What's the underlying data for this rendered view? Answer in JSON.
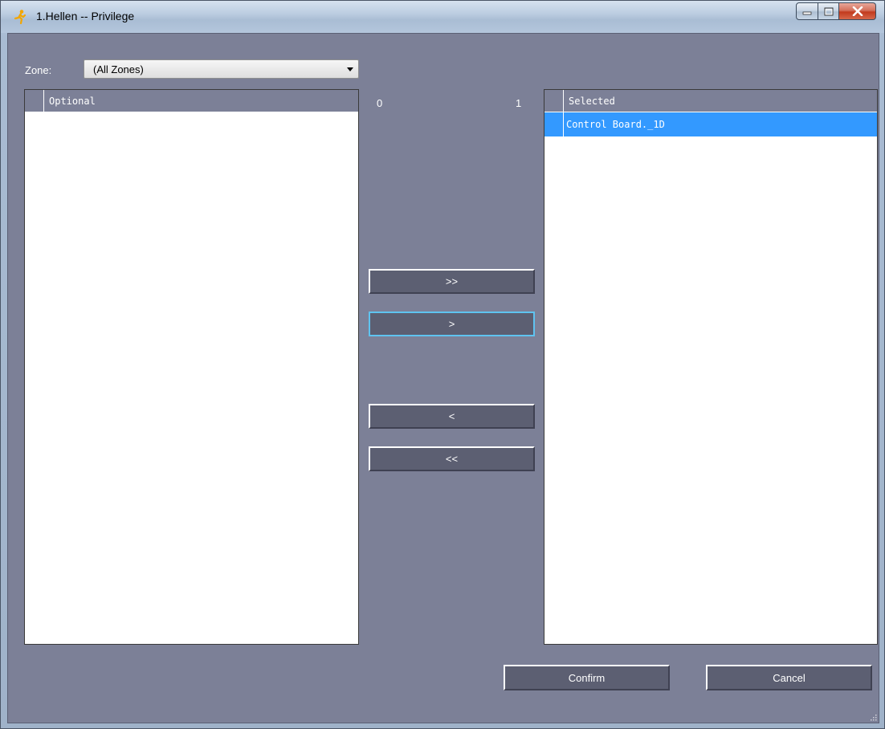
{
  "window": {
    "title": "1.Hellen -- Privilege"
  },
  "zone": {
    "label": "Zone:",
    "selected": "(All Zones)"
  },
  "optional_list": {
    "header": "Optional",
    "count": "0",
    "items": []
  },
  "selected_list": {
    "header": "Selected",
    "count": "1",
    "items": [
      "Control Board._1D"
    ]
  },
  "move_buttons": {
    "add_all": ">>",
    "add_one": ">",
    "remove_one": "<",
    "remove_all": "<<"
  },
  "actions": {
    "confirm": "Confirm",
    "cancel": "Cancel"
  },
  "colors": {
    "client_bg": "#7c8097",
    "selection": "#3399ff",
    "button_bg": "#5c5f72",
    "focus_border": "#5fc3f0"
  },
  "icons": {
    "app": "runner-icon",
    "minimize": "minimize-icon",
    "maximize": "maximize-icon",
    "close": "close-icon",
    "dropdown": "chevron-down-icon",
    "grip": "resize-grip-icon"
  }
}
